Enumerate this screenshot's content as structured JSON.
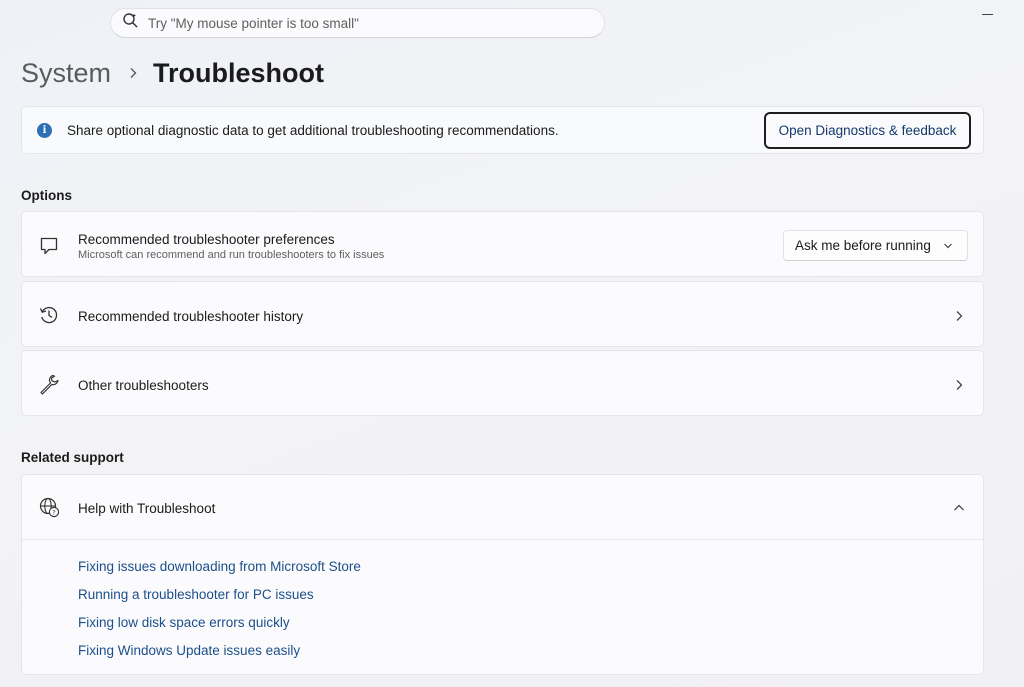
{
  "search": {
    "placeholder": "Try \"My mouse pointer is too small\""
  },
  "breadcrumb": {
    "parent": "System",
    "current": "Troubleshoot"
  },
  "banner": {
    "text": "Share optional diagnostic data to get additional troubleshooting recommendations.",
    "button_label": "Open Diagnostics & feedback",
    "icon": "info-icon"
  },
  "options": {
    "heading": "Options",
    "items": [
      {
        "title": "Recommended troubleshooter preferences",
        "subtitle": "Microsoft can recommend and run troubleshooters to fix issues",
        "icon": "chat-bubble-icon",
        "dropdown_value": "Ask me before running"
      },
      {
        "title": "Recommended troubleshooter history",
        "icon": "history-icon"
      },
      {
        "title": "Other troubleshooters",
        "icon": "wrench-icon"
      }
    ]
  },
  "related": {
    "heading": "Related support",
    "help": {
      "title": "Help with Troubleshoot",
      "icon": "globe-help-icon",
      "links": [
        "Fixing issues downloading from Microsoft Store",
        "Running a troubleshooter for PC issues",
        "Fixing low disk space errors quickly",
        "Fixing Windows Update issues easily"
      ]
    }
  },
  "colors": {
    "link": "#1b4f8a",
    "accent": "#2f6fb5"
  }
}
